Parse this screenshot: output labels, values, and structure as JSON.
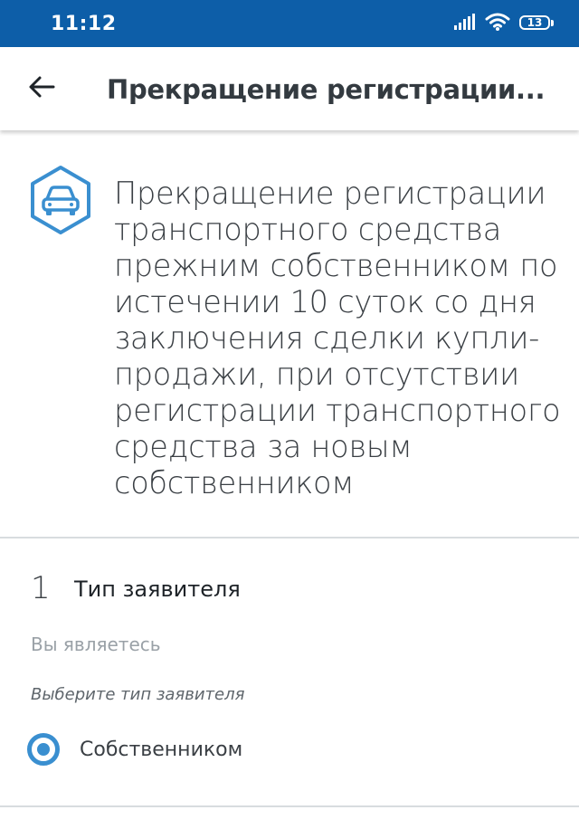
{
  "status_bar": {
    "time": "11:12",
    "battery": "13",
    "icons": [
      "signal-icon",
      "wifi-icon",
      "battery-icon"
    ]
  },
  "app_bar": {
    "back_icon": "arrow-left-icon",
    "title": "Прекращение регистрации..."
  },
  "service": {
    "icon": "car-icon",
    "title": "Прекращение регистрации транспортного средства прежним собственником по истечении 10 суток со дня заключения сделки купли-продажи, при отсутствии регистрации транспортного средства за новым собственником"
  },
  "step": {
    "number": "1",
    "title": "Тип заявителя",
    "question": "Вы являетесь",
    "hint": "Выберите тип заявителя",
    "options": [
      {
        "label": "Собственником",
        "selected": true
      }
    ]
  },
  "colors": {
    "status_bar": "#0d5ea8",
    "accent": "#3a8fd0",
    "title_text": "#333a40",
    "muted_text": "#9aa1a7"
  }
}
